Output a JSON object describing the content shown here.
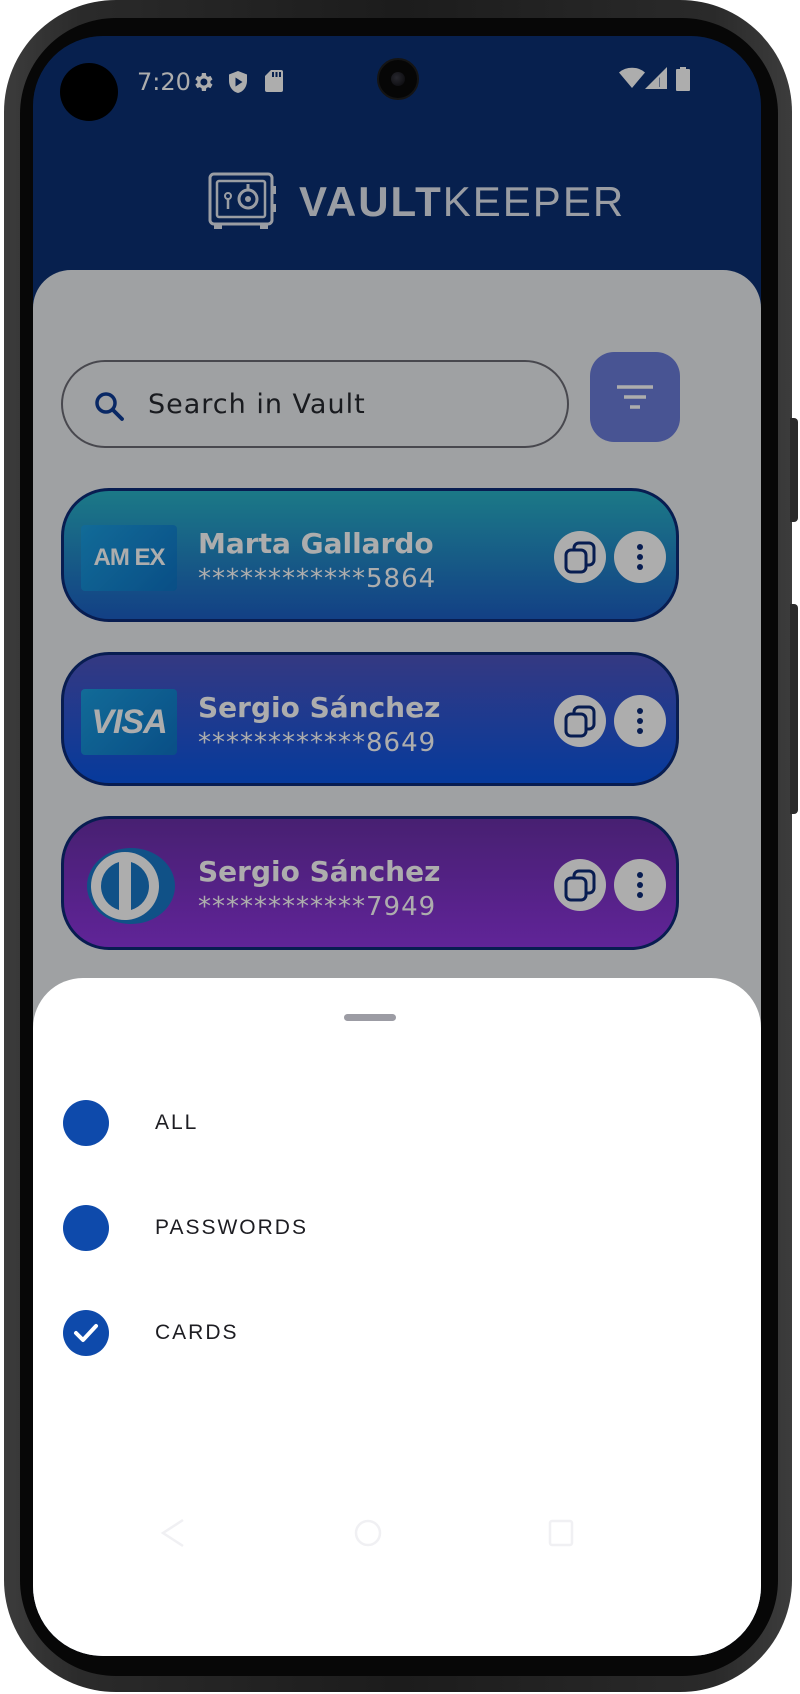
{
  "status_bar": {
    "time": "7:20"
  },
  "app": {
    "name_bold": "VAULT",
    "name_light": "KEEPER"
  },
  "search": {
    "placeholder": "Search in Vault"
  },
  "cards": [
    {
      "brand": "AM EX",
      "holder": "Marta Gallardo",
      "number": "************5864"
    },
    {
      "brand": "VISA",
      "holder": "Sergio Sánchez",
      "number": "************8649"
    },
    {
      "brand": "diners-club",
      "holder": "Sergio Sánchez",
      "number": "************7949"
    }
  ],
  "filter_sheet": {
    "options": [
      {
        "label": "ALL",
        "selected": false
      },
      {
        "label": "PASSWORDS",
        "selected": false
      },
      {
        "label": "CARDS",
        "selected": true
      }
    ]
  },
  "colors": {
    "primary": "#0b3073",
    "accent": "#0e4aab",
    "filter_button": "#6b7cd9"
  }
}
